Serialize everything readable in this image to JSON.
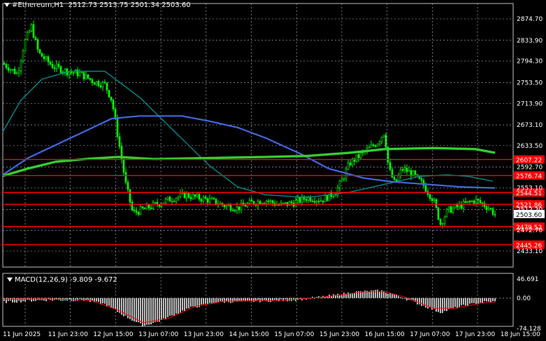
{
  "header": {
    "symbol_label": "#Ethereum,H1",
    "ohlc": "2512.73 2513.75 2501.34 2503.60"
  },
  "price_axis": {
    "ticks": [
      "2874.70",
      "2833.90",
      "2794.30",
      "2753.50",
      "2713.90",
      "2673.10",
      "2633.50",
      "2592.70",
      "2553.10",
      "2512.30",
      "2472.70",
      "2433.10"
    ],
    "min": 2433.1,
    "max": 2874.7
  },
  "levels": [
    {
      "label": "2607.22",
      "value": 2607.22
    },
    {
      "label": "2576.74",
      "value": 2576.74
    },
    {
      "label": "2544.51",
      "value": 2544.51
    },
    {
      "label": "2521.86",
      "value": 2521.86
    },
    {
      "label": "2479.52",
      "value": 2479.52
    },
    {
      "label": "2445.26",
      "value": 2445.26
    }
  ],
  "current_price": "2503.60",
  "macd": {
    "title": "MACD(12,26,9) -9.809 -9.672",
    "ticks": [
      "46.691",
      "0.00",
      "-74.128"
    ],
    "min": -74.128,
    "max": 46.691
  },
  "time_axis": {
    "labels": [
      "11 Jun 2025",
      "11 Jun 23:00",
      "12 Jun 15:00",
      "13 Jun 07:00",
      "13 Jun 23:00",
      "14 Jun 15:00",
      "15 Jun 07:00",
      "15 Jun 23:00",
      "16 Jun 15:00",
      "17 Jun 07:00",
      "17 Jun 23:00",
      "18 Jun 15:00"
    ]
  },
  "colors": {
    "background": "#000000",
    "grid": "#c0c0c0",
    "candles": "#00ff00",
    "level_line": "#ff0000",
    "level_label_bg": "#ff0000",
    "ma_fast": "#008b8b",
    "ma_mid": "#4169e1",
    "ma_slow": "#32cd32",
    "macd_hist": "#c0c0c0",
    "macd_signal": "#ff0000"
  }
}
